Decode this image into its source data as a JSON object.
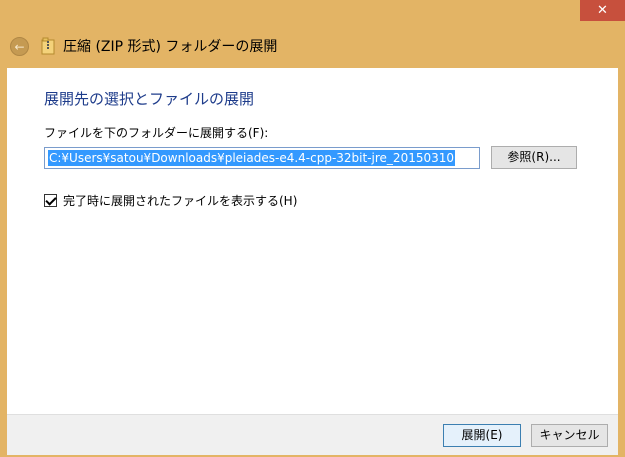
{
  "window": {
    "title": "圧縮 (ZIP 形式) フォルダーの展開",
    "close_glyph": "✕",
    "back_glyph": "←"
  },
  "dialog": {
    "heading": "展開先の選択とファイルの展開",
    "field_label": "ファイルを下のフォルダーに展開する(F):",
    "path_value": "C:¥Users¥satou¥Downloads¥pleiades-e4.4-cpp-32bit-jre_20150310",
    "browse_label": "参照(R)...",
    "show_files_checked": true,
    "show_files_label": "完了時に展開されたファイルを表示する(H)"
  },
  "footer": {
    "extract_label": "展開(E)",
    "cancel_label": "キャンセル"
  },
  "icons": {
    "back": "back-arrow-icon",
    "zip_folder": "zip-folder-icon",
    "close": "close-icon",
    "checkbox": "checkmark-icon"
  },
  "colors": {
    "titlebar": "#e3b465",
    "heading": "#1e3c8b",
    "selection": "#3399ff",
    "close": "#c7503d"
  }
}
